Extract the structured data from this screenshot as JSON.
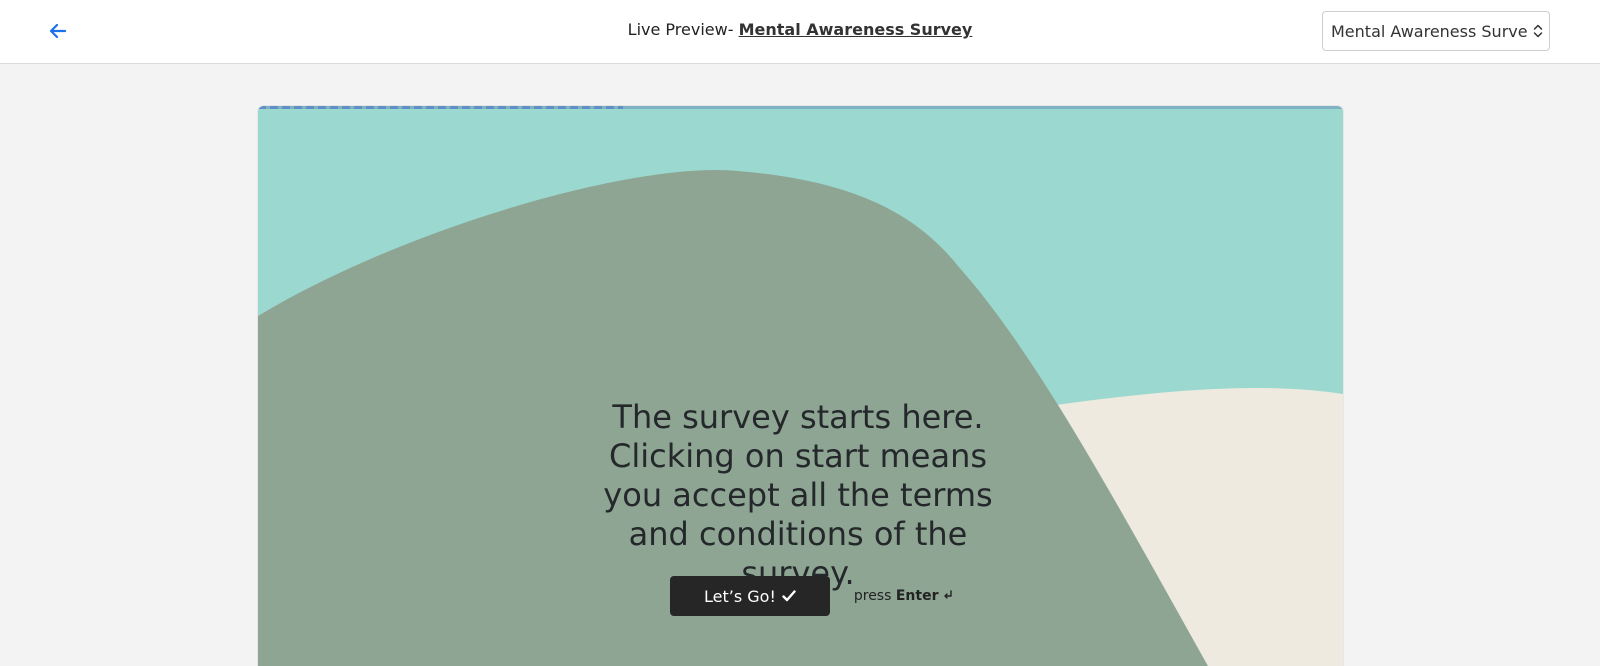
{
  "header": {
    "back_icon": "arrow-left-icon",
    "title_prefix": "Live Preview-",
    "title_link": "Mental Awareness Survey",
    "selector_value": "Mental Awareness Survey",
    "selector_icon": "updown-chevron-icon",
    "accent_color": "#1a73e8"
  },
  "survey": {
    "headline": "The survey starts here. Clicking on start means you accept all the terms and conditions of the survey.",
    "start_button_label": "Let’s Go!",
    "start_button_icon": "check-icon",
    "hint_prefix": "press",
    "hint_key": "Enter",
    "hint_icon": "enter-key-icon",
    "colors": {
      "background": "#9bd8cf",
      "shape_main": "#8ea594",
      "shape_accent": "#eeeae0",
      "button": "#262626"
    }
  }
}
